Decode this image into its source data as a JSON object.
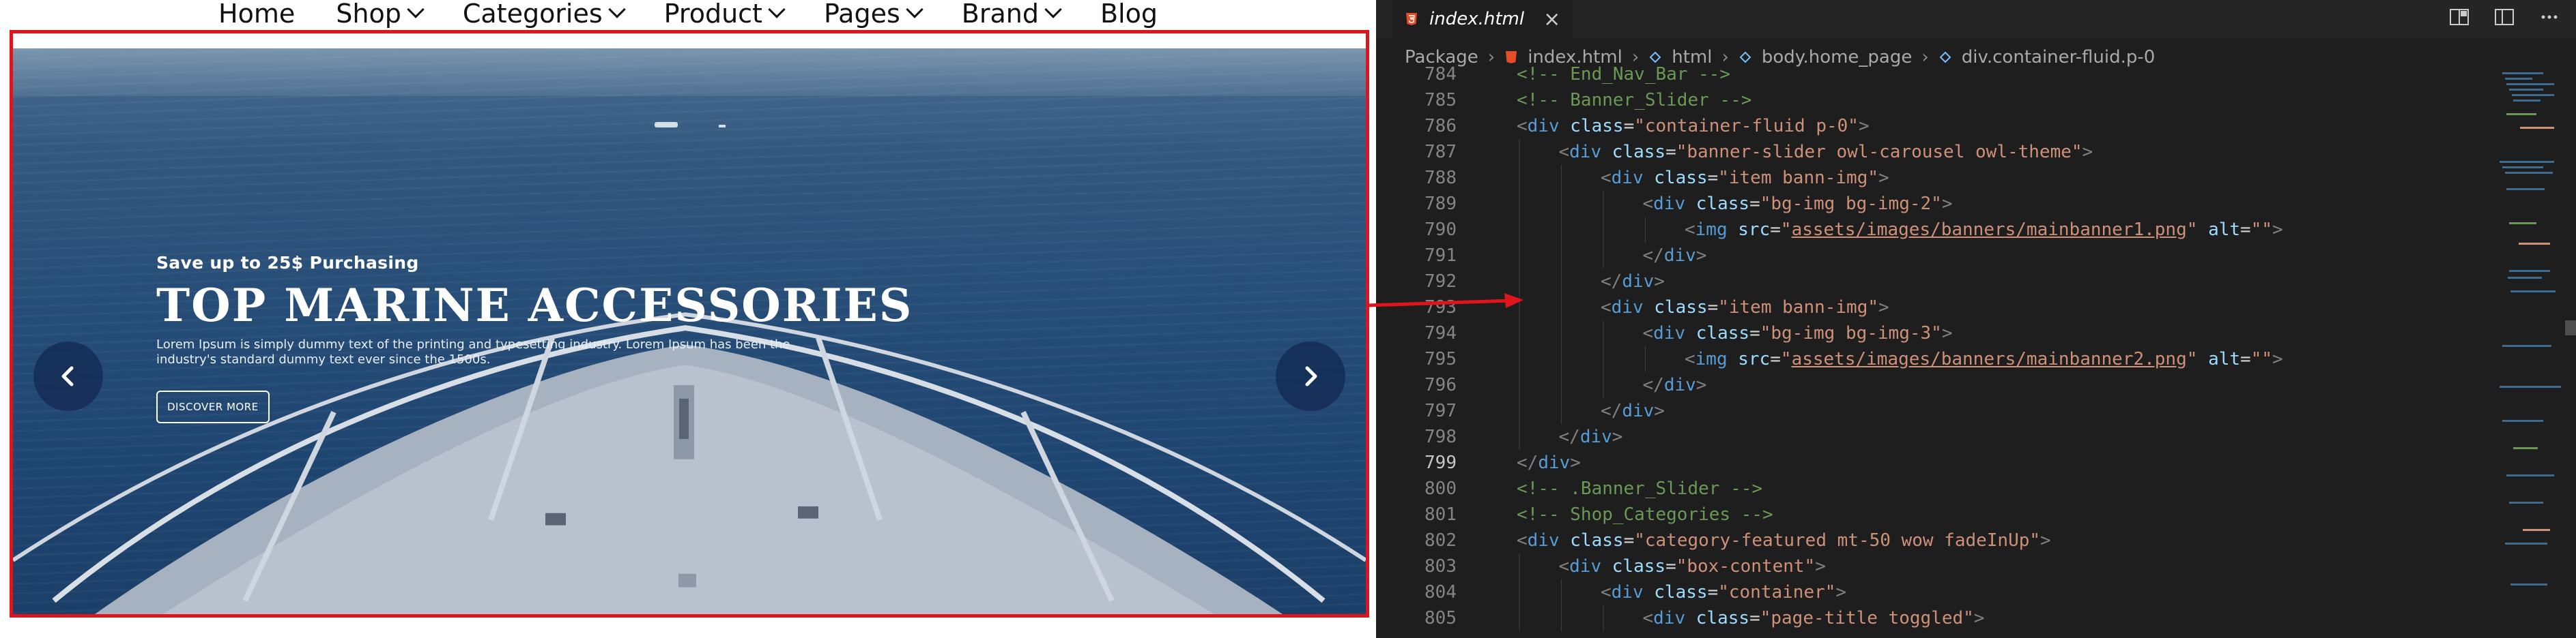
{
  "site": {
    "nav": [
      {
        "label": "Home",
        "has_dropdown": false
      },
      {
        "label": "Shop",
        "has_dropdown": true
      },
      {
        "label": "Categories",
        "has_dropdown": true
      },
      {
        "label": "Product",
        "has_dropdown": true
      },
      {
        "label": "Pages",
        "has_dropdown": true
      },
      {
        "label": "Brand",
        "has_dropdown": true
      },
      {
        "label": "Blog",
        "has_dropdown": false
      }
    ],
    "banner": {
      "eyebrow": "Save up to 25$ Purchasing",
      "headline": "TOP MARINE ACCESSORIES",
      "description": "Lorem Ipsum is simply dummy text of the printing and typesetting industry. Lorem Ipsum has been the industry's standard dummy text ever since the 1500s.",
      "cta": "DISCOVER MORE",
      "prev_icon": "chevron-left-icon",
      "next_icon": "chevron-right-icon"
    },
    "highlight_color": "#e0141b"
  },
  "editor": {
    "tab": {
      "label": "index.html",
      "close": "×"
    },
    "actions": [
      "split-editor-icon",
      "toggle-panel-icon",
      "more-icon"
    ],
    "breadcrumb": [
      "Package",
      "index.html",
      "html",
      "body.home_page",
      "div.container-fluid.p-0"
    ],
    "lines": [
      {
        "n": "784",
        "indent": 0,
        "html": "<span class=\"c-comment\">&lt;!-- End_Nav_Bar --&gt;</span>"
      },
      {
        "n": "785",
        "indent": 0,
        "html": "<span class=\"c-comment\">&lt;!-- Banner_Slider --&gt;</span>"
      },
      {
        "n": "786",
        "indent": 0,
        "html": "<span class=\"c-punc\">&lt;</span><span class=\"c-tag\">div</span> <span class=\"c-attr\">class</span>=<span class=\"c-str\">\"container-fluid p-0\"</span><span class=\"c-punc\">&gt;</span>"
      },
      {
        "n": "787",
        "indent": 1,
        "html": "<span class=\"c-punc\">&lt;</span><span class=\"c-tag\">div</span> <span class=\"c-attr\">class</span>=<span class=\"c-str\">\"banner-slider owl-carousel owl-theme\"</span><span class=\"c-punc\">&gt;</span>"
      },
      {
        "n": "788",
        "indent": 2,
        "html": "<span class=\"c-punc\">&lt;</span><span class=\"c-tag\">div</span> <span class=\"c-attr\">class</span>=<span class=\"c-str\">\"item bann-img\"</span><span class=\"c-punc\">&gt;</span>"
      },
      {
        "n": "789",
        "indent": 3,
        "html": "<span class=\"c-punc\">&lt;</span><span class=\"c-tag\">div</span> <span class=\"c-attr\">class</span>=<span class=\"c-str\">\"bg-img bg-img-2\"</span><span class=\"c-punc\">&gt;</span>"
      },
      {
        "n": "790",
        "indent": 4,
        "html": "<span class=\"c-punc\">&lt;</span><span class=\"c-tag\">img</span> <span class=\"c-attr\">src</span>=<span class=\"c-str\">\"</span><span class=\"c-link\">assets/images/banners/mainbanner1.png</span><span class=\"c-str\">\"</span> <span class=\"c-attr\">alt</span>=<span class=\"c-str\">\"\"</span><span class=\"c-punc\">&gt;</span>"
      },
      {
        "n": "791",
        "indent": 3,
        "html": "<span class=\"c-punc\">&lt;/</span><span class=\"c-tag\">div</span><span class=\"c-punc\">&gt;</span>"
      },
      {
        "n": "792",
        "indent": 2,
        "html": "<span class=\"c-punc\">&lt;/</span><span class=\"c-tag\">div</span><span class=\"c-punc\">&gt;</span>"
      },
      {
        "n": "793",
        "indent": 2,
        "html": "<span class=\"c-punc\">&lt;</span><span class=\"c-tag\">div</span> <span class=\"c-attr\">class</span>=<span class=\"c-str\">\"item bann-img\"</span><span class=\"c-punc\">&gt;</span>"
      },
      {
        "n": "794",
        "indent": 3,
        "html": "<span class=\"c-punc\">&lt;</span><span class=\"c-tag\">div</span> <span class=\"c-attr\">class</span>=<span class=\"c-str\">\"bg-img bg-img-3\"</span><span class=\"c-punc\">&gt;</span>"
      },
      {
        "n": "795",
        "indent": 4,
        "html": "<span class=\"c-punc\">&lt;</span><span class=\"c-tag\">img</span> <span class=\"c-attr\">src</span>=<span class=\"c-str\">\"</span><span class=\"c-link\">assets/images/banners/mainbanner2.png</span><span class=\"c-str\">\"</span> <span class=\"c-attr\">alt</span>=<span class=\"c-str\">\"\"</span><span class=\"c-punc\">&gt;</span>"
      },
      {
        "n": "796",
        "indent": 3,
        "html": "<span class=\"c-punc\">&lt;/</span><span class=\"c-tag\">div</span><span class=\"c-punc\">&gt;</span>"
      },
      {
        "n": "797",
        "indent": 2,
        "html": "<span class=\"c-punc\">&lt;/</span><span class=\"c-tag\">div</span><span class=\"c-punc\">&gt;</span>"
      },
      {
        "n": "798",
        "indent": 1,
        "html": "<span class=\"c-punc\">&lt;/</span><span class=\"c-tag\">div</span><span class=\"c-punc\">&gt;</span>"
      },
      {
        "n": "799",
        "indent": 0,
        "active": true,
        "html": "<span class=\"c-punc\">&lt;/</span><span class=\"c-tag\">div</span><span class=\"c-punc\">&gt;</span>"
      },
      {
        "n": "800",
        "indent": 0,
        "html": "<span class=\"c-comment\">&lt;!-- .Banner_Slider --&gt;</span>"
      },
      {
        "n": "801",
        "indent": 0,
        "html": "<span class=\"c-comment\">&lt;!-- Shop_Categories --&gt;</span>"
      },
      {
        "n": "802",
        "indent": 0,
        "html": "<span class=\"c-punc\">&lt;</span><span class=\"c-tag\">div</span> <span class=\"c-attr\">class</span>=<span class=\"c-str\">\"category-featured mt-50 wow fadeInUp\"</span><span class=\"c-punc\">&gt;</span>"
      },
      {
        "n": "803",
        "indent": 1,
        "html": "<span class=\"c-punc\">&lt;</span><span class=\"c-tag\">div</span> <span class=\"c-attr\">class</span>=<span class=\"c-str\">\"box-content\"</span><span class=\"c-punc\">&gt;</span>"
      },
      {
        "n": "804",
        "indent": 2,
        "html": "<span class=\"c-punc\">&lt;</span><span class=\"c-tag\">div</span> <span class=\"c-attr\">class</span>=<span class=\"c-str\">\"container\"</span><span class=\"c-punc\">&gt;</span>"
      },
      {
        "n": "805",
        "indent": 3,
        "html": "<span class=\"c-punc\">&lt;</span><span class=\"c-tag\">div</span> <span class=\"c-attr\">class</span>=<span class=\"c-str\">\"page-title toggled\"</span><span class=\"c-punc\">&gt;</span>"
      }
    ]
  }
}
